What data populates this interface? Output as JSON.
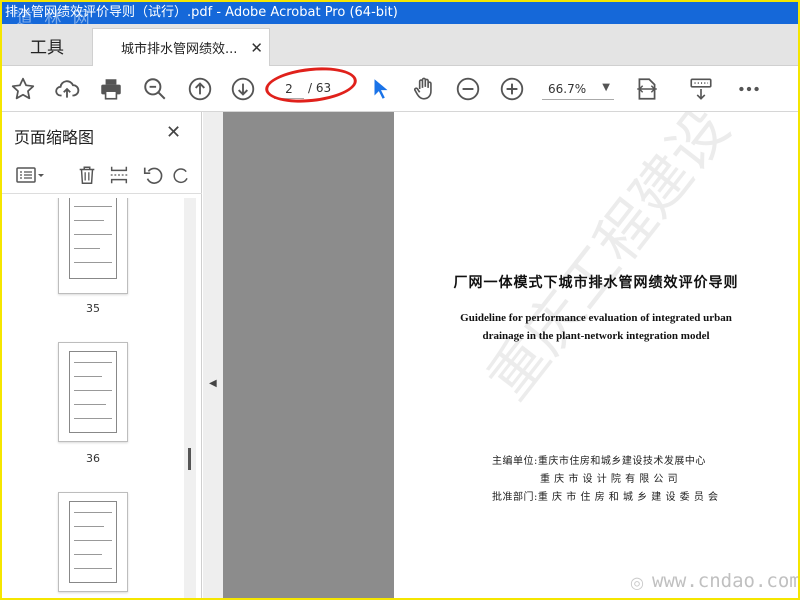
{
  "window": {
    "title": "排水管网绩效评价导则（试行）.pdf - Adobe Acrobat Pro (64-bit)",
    "watermark": "道 林 网"
  },
  "tabs": {
    "tools_label": "工具",
    "doc_label": "城市排水管网绩效...",
    "close_glyph": "✕"
  },
  "toolbar": {
    "current_page": "2",
    "total_pages": "/ 63",
    "zoom": "66.7%",
    "zoom_arrow": "▼"
  },
  "sidebar": {
    "title": "页面缩略图",
    "close_glyph": "✕",
    "thumbnails": [
      {
        "label": "35"
      },
      {
        "label": "36"
      },
      {
        "label": ""
      }
    ]
  },
  "document": {
    "title_cn": "厂网一体模式下城市排水管网绩效评价导则",
    "title_en_line1": "Guideline for performance evaluation of integrated urban",
    "title_en_line2": "drainage in the plant-network integration model",
    "units": [
      "主编单位:重庆市住房和城乡建设技术发展中心",
      "重 庆 市 设 计 院 有 限 公 司",
      "批准部门:重 庆 市 住 房 和 城 乡 建 设 委 员 会"
    ],
    "watermark_text": "重庆工程建设",
    "watermark_url": "www.cndao.com",
    "watermark_logo": "◎"
  },
  "colors": {
    "accent": "#1568d9",
    "highlight": "#e0211b",
    "select_tool": "#1a73e8"
  }
}
